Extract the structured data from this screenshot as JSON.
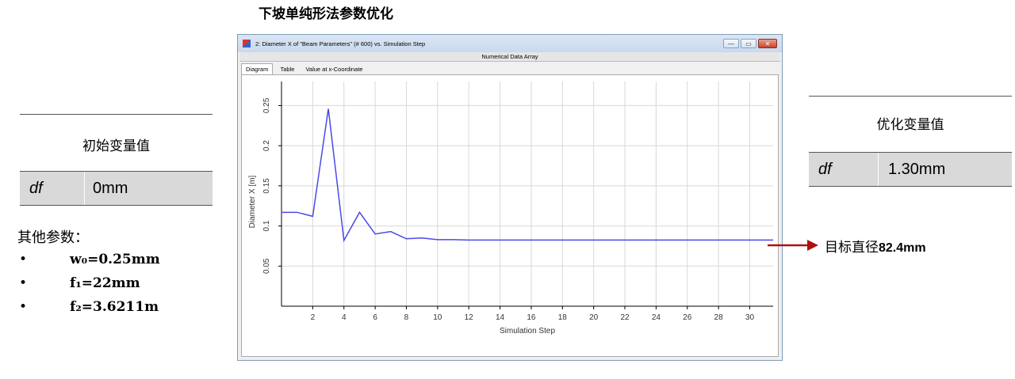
{
  "page_title": "下坡单纯形法参数优化",
  "initial": {
    "heading": "初始变量值",
    "var_name": "df",
    "var_value": "0mm"
  },
  "other_params": {
    "title": "其他参数：",
    "items": [
      {
        "bullet": "•",
        "text": "w₀=0.25mm"
      },
      {
        "bullet": "•",
        "text": "f₁=22mm"
      },
      {
        "bullet": "•",
        "text": "f₂=3.6211m"
      }
    ]
  },
  "optimized": {
    "heading": "优化变量值",
    "var_name": "df",
    "var_value": "1.30mm"
  },
  "target": {
    "label": "目标直径",
    "value": "82.4mm",
    "arrow_color": "#b01010"
  },
  "window": {
    "title": "2: Diameter X of \"Beam Parameters\" (# 600) vs. Simulation Step",
    "subheader": "Numerical Data Array",
    "tabs": [
      "Diagram",
      "Table",
      "Value at x-Coordinate"
    ],
    "active_tab": 0,
    "buttons": {
      "minimize": "—",
      "maximize": "▭",
      "close": "✕"
    }
  },
  "chart_data": {
    "type": "line",
    "xlabel": "Simulation Step",
    "ylabel": "Diameter X [m]",
    "xlim": [
      0,
      31.5
    ],
    "ylim": [
      0,
      0.28
    ],
    "xticks": [
      2,
      4,
      6,
      8,
      10,
      12,
      14,
      16,
      18,
      20,
      22,
      24,
      26,
      28,
      30
    ],
    "yticks": [
      0.05,
      0.1,
      0.15,
      0.2,
      0.25
    ],
    "grid": true,
    "line_color": "#4a4ae8",
    "series": [
      {
        "x": [
          0,
          1,
          2,
          3,
          4,
          5,
          6,
          7,
          8,
          9,
          10,
          11,
          12,
          13,
          14,
          15,
          16,
          17,
          18,
          19,
          20,
          21,
          22,
          23,
          24,
          25,
          26,
          27,
          28,
          29,
          30,
          31,
          31.5
        ],
        "values": [
          0.117,
          0.117,
          0.112,
          0.246,
          0.082,
          0.117,
          0.09,
          0.093,
          0.084,
          0.085,
          0.083,
          0.083,
          0.0825,
          0.0825,
          0.0824,
          0.0824,
          0.0824,
          0.0824,
          0.0824,
          0.0824,
          0.0824,
          0.0824,
          0.0824,
          0.0824,
          0.0824,
          0.0824,
          0.0824,
          0.0824,
          0.0824,
          0.0824,
          0.0824,
          0.0824,
          0.0824
        ]
      }
    ]
  }
}
